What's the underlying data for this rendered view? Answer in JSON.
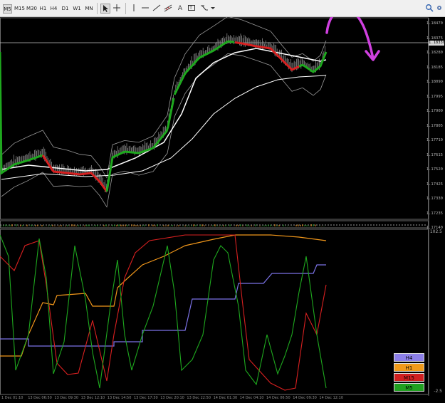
{
  "toolbar": {
    "timeframes": [
      "M5",
      "M15",
      "M30",
      "H1",
      "H4",
      "D1",
      "W1",
      "MN"
    ],
    "icons": [
      "cursor-icon",
      "crosshair-icon",
      "vertical-line-icon",
      "horizontal-line-icon",
      "trendline-icon",
      "channel-icon",
      "text-icon",
      "label-icon",
      "shapes-dropdown-icon"
    ],
    "text_tool_label": "A",
    "right_icons": [
      "search-icon",
      "settings-icon"
    ]
  },
  "price_scale": {
    "labels": [
      "1.18470",
      "1.18375",
      "1.18280",
      "1.18185",
      "1.18090",
      "1.17995",
      "1.17900",
      "1.17805",
      "1.17710",
      "1.17615",
      "1.17520",
      "1.17425",
      "1.17330",
      "1.17235",
      "1.17140"
    ],
    "current_price": "1.18330"
  },
  "oscillator": {
    "top_label": "102.5",
    "bottom_label": "-2.5"
  },
  "legend": [
    {
      "label": "H4",
      "bg": "#8c7fe8",
      "fg": "#000000"
    },
    {
      "label": "H1",
      "bg": "#f09a1a",
      "fg": "#000000"
    },
    {
      "label": "M15",
      "bg": "#d02020",
      "fg": "#000000"
    },
    {
      "label": "M5",
      "bg": "#20a020",
      "fg": "#000000"
    }
  ],
  "time_axis": [
    "1 Dec 01:10",
    "13 Dec 06:50",
    "13 Dec 09:30",
    "13 Dec 12:10",
    "13 Dec 14:50",
    "13 Dec 17:30",
    "13 Dec 20:10",
    "13 Dec 22:50",
    "14 Dec 01:30",
    "14 Dec 04:10",
    "14 Dec 06:50",
    "14 Dec 09:30",
    "14 Dec 12:10"
  ],
  "colors": {
    "h4": "#7b72e6",
    "h1": "#f0961a",
    "m15": "#d82020",
    "m5": "#1ea81e",
    "price_bar": "#8a8a8a",
    "ma_white": "#ffffff",
    "band_gray": "#9a9a9a",
    "annotation": "#d040e0"
  }
}
